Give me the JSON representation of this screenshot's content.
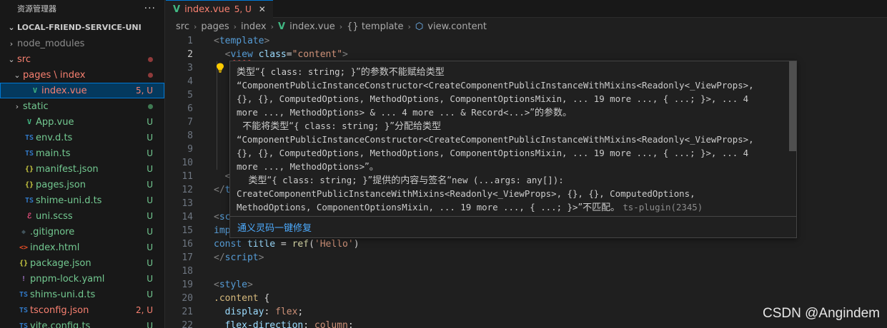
{
  "sidebar": {
    "title": "资源管理器",
    "more_label": "···",
    "project": "LOCAL-FRIEND-SERVICE-UNI",
    "items": [
      {
        "name": "node_modules",
        "chev": "›",
        "icon": "",
        "icon_name": "folder-icon",
        "status": "",
        "name_color": "#8c8c8c",
        "status_color": "",
        "indent": 1,
        "dot": ""
      },
      {
        "name": "src",
        "chev": "⌄",
        "icon": "",
        "icon_name": "folder-icon",
        "status": "",
        "name_color": "#f88070",
        "status_color": "",
        "indent": 1,
        "dot": "#8f3a3a"
      },
      {
        "name": "pages \\ index",
        "chev": "⌄",
        "icon": "",
        "icon_name": "folder-icon",
        "status": "",
        "name_color": "#f88070",
        "status_color": "",
        "indent": 2,
        "dot": "#8f3a3a"
      },
      {
        "name": "index.vue",
        "chev": "",
        "icon": "V",
        "icon_name": "vue-file-icon",
        "status": "5, U",
        "name_color": "#f88070",
        "status_color": "#f88070",
        "indent": 3,
        "dot": "",
        "selected": true
      },
      {
        "name": "static",
        "chev": "›",
        "icon": "",
        "icon_name": "folder-icon",
        "status": "",
        "name_color": "#73c991",
        "status_color": "",
        "indent": 2,
        "dot": "#3f7a52"
      },
      {
        "name": "App.vue",
        "chev": "",
        "icon": "V",
        "icon_name": "vue-file-icon",
        "status": "U",
        "name_color": "#73c991",
        "status_color": "#73c991",
        "indent": 2,
        "dot": ""
      },
      {
        "name": "env.d.ts",
        "chev": "",
        "icon": "TS",
        "icon_name": "typescript-file-icon",
        "status": "U",
        "name_color": "#73c991",
        "status_color": "#73c991",
        "indent": 2,
        "dot": ""
      },
      {
        "name": "main.ts",
        "chev": "",
        "icon": "TS",
        "icon_name": "typescript-file-icon",
        "status": "U",
        "name_color": "#73c991",
        "status_color": "#73c991",
        "indent": 2,
        "dot": ""
      },
      {
        "name": "manifest.json",
        "chev": "",
        "icon": "{}",
        "icon_name": "json-file-icon",
        "status": "U",
        "name_color": "#73c991",
        "status_color": "#73c991",
        "indent": 2,
        "dot": ""
      },
      {
        "name": "pages.json",
        "chev": "",
        "icon": "{}",
        "icon_name": "json-file-icon",
        "status": "U",
        "name_color": "#73c991",
        "status_color": "#73c991",
        "indent": 2,
        "dot": ""
      },
      {
        "name": "shime-uni.d.ts",
        "chev": "",
        "icon": "TS",
        "icon_name": "typescript-file-icon",
        "status": "U",
        "name_color": "#73c991",
        "status_color": "#73c991",
        "indent": 2,
        "dot": ""
      },
      {
        "name": "uni.scss",
        "chev": "",
        "icon": "ℰ",
        "icon_name": "scss-file-icon",
        "status": "U",
        "name_color": "#73c991",
        "status_color": "#73c991",
        "indent": 2,
        "dot": ""
      },
      {
        "name": ".gitignore",
        "chev": "",
        "icon": "◆",
        "icon_name": "git-file-icon",
        "status": "U",
        "name_color": "#73c991",
        "status_color": "#73c991",
        "indent": 1,
        "dot": ""
      },
      {
        "name": "index.html",
        "chev": "",
        "icon": "<>",
        "icon_name": "html-file-icon",
        "status": "U",
        "name_color": "#73c991",
        "status_color": "#73c991",
        "indent": 1,
        "dot": ""
      },
      {
        "name": "package.json",
        "chev": "",
        "icon": "{}",
        "icon_name": "json-file-icon",
        "status": "U",
        "name_color": "#73c991",
        "status_color": "#73c991",
        "indent": 1,
        "dot": ""
      },
      {
        "name": "pnpm-lock.yaml",
        "chev": "",
        "icon": "!",
        "icon_name": "yaml-file-icon",
        "status": "U",
        "name_color": "#73c991",
        "status_color": "#73c991",
        "indent": 1,
        "dot": ""
      },
      {
        "name": "shims-uni.d.ts",
        "chev": "",
        "icon": "TS",
        "icon_name": "typescript-file-icon",
        "status": "U",
        "name_color": "#73c991",
        "status_color": "#73c991",
        "indent": 1,
        "dot": ""
      },
      {
        "name": "tsconfig.json",
        "chev": "",
        "icon": "TS",
        "icon_name": "tsconfig-file-icon",
        "status": "2, U",
        "name_color": "#f88070",
        "status_color": "#f88070",
        "indent": 1,
        "dot": ""
      },
      {
        "name": "vite.config.ts",
        "chev": "",
        "icon": "TS",
        "icon_name": "typescript-file-icon",
        "status": "U",
        "name_color": "#73c991",
        "status_color": "#73c991",
        "indent": 1,
        "dot": ""
      }
    ]
  },
  "tab": {
    "icon": "V",
    "name": "index.vue",
    "status": "5, U",
    "close": "✕"
  },
  "breadcrumb": [
    "src",
    "pages",
    "index",
    "index.vue",
    "{} template",
    "view.content"
  ],
  "code": {
    "active_line": 2,
    "lines": [
      {
        "n": "1",
        "segs": [
          [
            "tk-punc",
            "<"
          ],
          [
            "tk-tag",
            "template"
          ],
          [
            "tk-punc",
            ">"
          ]
        ]
      },
      {
        "n": "2",
        "segs": [
          [
            "tk-plain",
            "  "
          ],
          [
            "tk-punc",
            "<"
          ],
          [
            "tk-tag squiggle",
            "view"
          ],
          [
            "tk-plain",
            " "
          ],
          [
            "tk-attr",
            "class"
          ],
          [
            "tk-plain",
            "="
          ],
          [
            "tk-str",
            "\"content\""
          ],
          [
            "tk-punc",
            ">"
          ]
        ]
      },
      {
        "n": "3",
        "segs": []
      },
      {
        "n": "4",
        "segs": []
      },
      {
        "n": "5",
        "segs": []
      },
      {
        "n": "6",
        "segs": []
      },
      {
        "n": "7",
        "segs": []
      },
      {
        "n": "8",
        "segs": []
      },
      {
        "n": "9",
        "segs": []
      },
      {
        "n": "10",
        "segs": []
      },
      {
        "n": "11",
        "segs": [
          [
            "tk-plain",
            "  "
          ],
          [
            "tk-punc",
            "<"
          ]
        ]
      },
      {
        "n": "12",
        "segs": [
          [
            "tk-punc",
            "</"
          ],
          [
            "tk-tag",
            "t"
          ]
        ]
      },
      {
        "n": "13",
        "segs": []
      },
      {
        "n": "14",
        "segs": [
          [
            "tk-punc",
            "<"
          ],
          [
            "tk-tag",
            "sc"
          ]
        ]
      },
      {
        "n": "15",
        "segs": [
          [
            "tk-kw",
            "imp"
          ]
        ]
      },
      {
        "n": "16",
        "segs": [
          [
            "tk-kw",
            "const"
          ],
          [
            "tk-plain",
            " "
          ],
          [
            "tk-var",
            "title"
          ],
          [
            "tk-plain",
            " = "
          ],
          [
            "tk-fn",
            "ref"
          ],
          [
            "tk-plain",
            "("
          ],
          [
            "tk-str",
            "'Hello'"
          ],
          [
            "tk-plain",
            ")"
          ]
        ]
      },
      {
        "n": "17",
        "segs": [
          [
            "tk-punc",
            "</"
          ],
          [
            "tk-tag",
            "script"
          ],
          [
            "tk-punc",
            ">"
          ]
        ]
      },
      {
        "n": "18",
        "segs": []
      },
      {
        "n": "19",
        "segs": [
          [
            "tk-punc",
            "<"
          ],
          [
            "tk-tag",
            "style"
          ],
          [
            "tk-punc",
            ">"
          ]
        ]
      },
      {
        "n": "20",
        "segs": [
          [
            "tk-sel",
            ".content"
          ],
          [
            "tk-plain",
            " {"
          ]
        ]
      },
      {
        "n": "21",
        "segs": [
          [
            "tk-plain",
            "  "
          ],
          [
            "tk-attr",
            "display"
          ],
          [
            "tk-plain",
            ": "
          ],
          [
            "tk-str",
            "flex"
          ],
          [
            "tk-plain",
            ";"
          ]
        ]
      },
      {
        "n": "22",
        "segs": [
          [
            "tk-plain",
            "  "
          ],
          [
            "tk-attr",
            "flex-direction"
          ],
          [
            "tk-plain",
            ": "
          ],
          [
            "tk-str",
            "column"
          ],
          [
            "tk-plain",
            ";"
          ]
        ]
      }
    ]
  },
  "hover": {
    "lines": [
      [
        [
          "",
          "类型“"
        ],
        [
          "mono",
          "{ class: string; }"
        ],
        [
          "",
          "”的参数不能赋给类型"
        ]
      ],
      [
        [
          "mono",
          "“ComponentPublicInstanceConstructor<CreateComponentPublicInstanceWithMixins<Readonly<_ViewProps>,"
        ]
      ],
      [
        [
          "mono",
          "{}, {}, ComputedOptions, MethodOptions, ComponentOptionsMixin, ... 19 more ..., { ...; }>, ... 4"
        ]
      ],
      [
        [
          "mono",
          "more ..., MethodOptions> & ... 4 more ... & Record<...>"
        ],
        [
          "",
          "”的参数。"
        ]
      ],
      [
        [
          "",
          "  不能将类型“"
        ],
        [
          "mono",
          "{ class: string; }"
        ],
        [
          "",
          "”分配给类型"
        ]
      ],
      [
        [
          "mono",
          "“ComponentPublicInstanceConstructor<CreateComponentPublicInstanceWithMixins<Readonly<_ViewProps>,"
        ]
      ],
      [
        [
          "mono",
          "{}, {}, ComputedOptions, MethodOptions, ComponentOptionsMixin, ... 19 more ..., { ...; }>, ... 4"
        ]
      ],
      [
        [
          "mono",
          "more ..., MethodOptions>"
        ],
        [
          "",
          "”。"
        ]
      ],
      [
        [
          "",
          "    类型“"
        ],
        [
          "mono",
          "{ class: string; }"
        ],
        [
          "",
          "”提供的内容与签名“"
        ],
        [
          "mono",
          "new (...args: any[]):"
        ]
      ],
      [
        [
          "mono",
          "CreateComponentPublicInstanceWithMixins<Readonly<_ViewProps>, {}, {}, ComputedOptions,"
        ]
      ],
      [
        [
          "mono",
          "MethodOptions, ComponentOptionsMixin, ... 19 more ..., { ...; }>"
        ],
        [
          "",
          "”不匹配。 "
        ],
        [
          "src",
          "ts-plugin(2345)"
        ]
      ]
    ],
    "action": "通义灵码一键修复"
  },
  "watermark": "CSDN @Angindem"
}
